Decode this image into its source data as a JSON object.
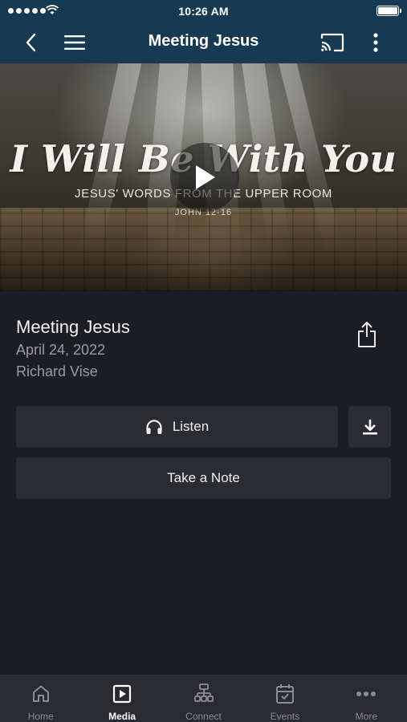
{
  "status_bar": {
    "time": "10:26 AM"
  },
  "nav": {
    "title": "Meeting Jesus"
  },
  "hero": {
    "title": "I Will Be With You",
    "subtitle": "JESUS' WORDS FROM THE UPPER ROOM",
    "reference": "JOHN 12-16"
  },
  "media": {
    "title": "Meeting Jesus",
    "date": "April 24, 2022",
    "speaker": "Richard Vise"
  },
  "actions": {
    "listen_label": "Listen",
    "note_label": "Take a Note"
  },
  "tabs": [
    {
      "label": "Home",
      "icon": "home-icon"
    },
    {
      "label": "Media",
      "icon": "media-icon",
      "active": true
    },
    {
      "label": "Connect",
      "icon": "connect-icon"
    },
    {
      "label": "Events",
      "icon": "events-icon"
    },
    {
      "label": "More",
      "icon": "more-icon"
    }
  ],
  "colors": {
    "nav_bg": "#163a52",
    "page_bg": "#1c1d22",
    "button_bg": "#2b2c31",
    "tab_bg": "#2a2b30"
  }
}
